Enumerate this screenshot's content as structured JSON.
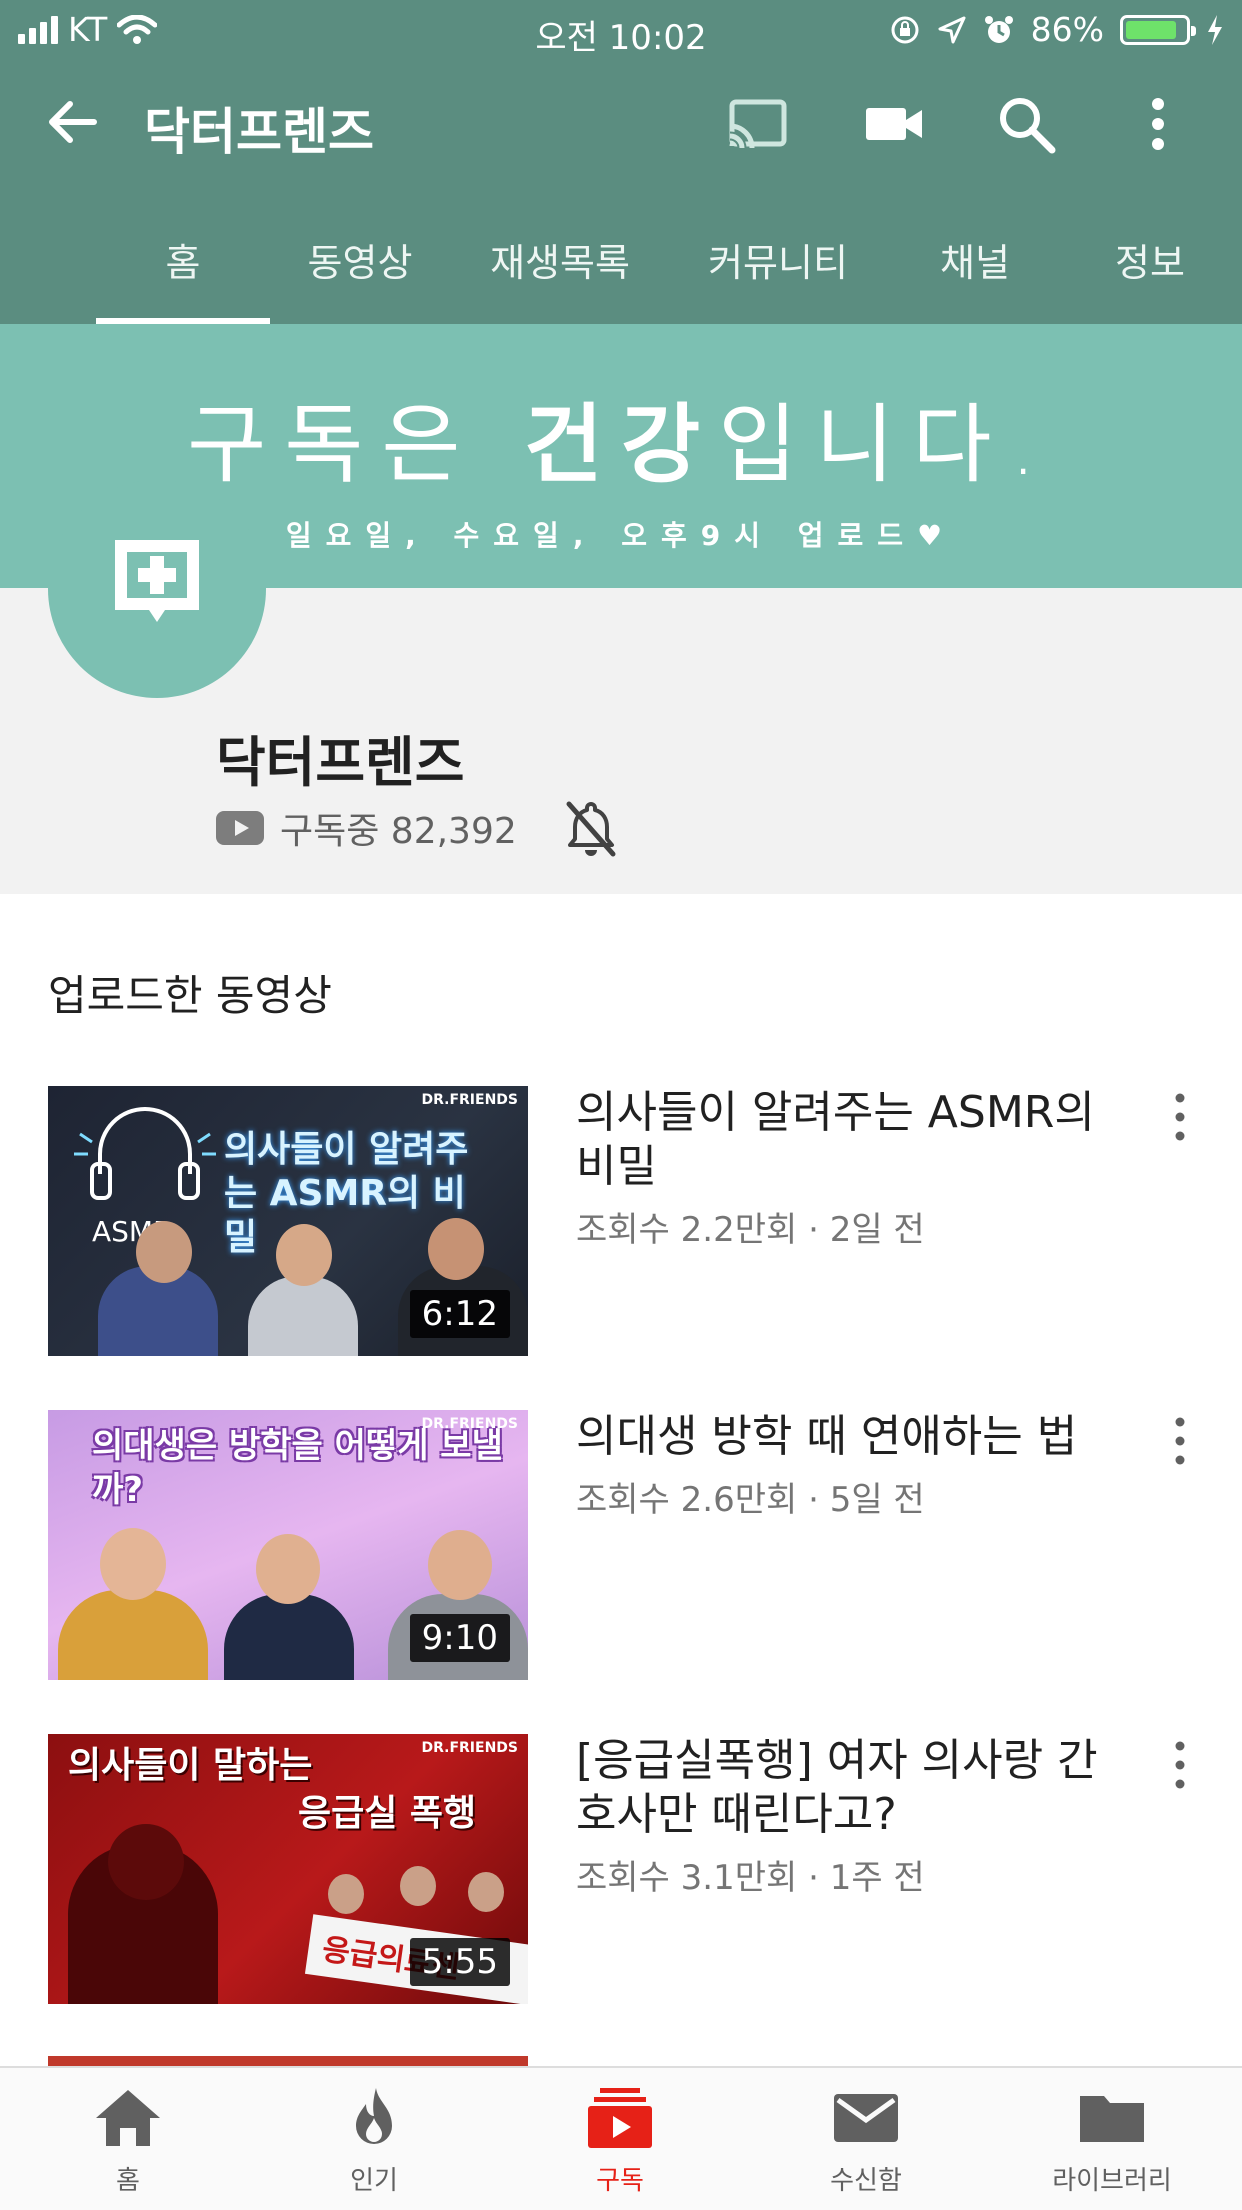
{
  "status_bar": {
    "carrier": "KT",
    "time": "오전 10:02",
    "battery": "86%",
    "battery_level": 0.86
  },
  "app_bar": {
    "title": "닥터프렌즈",
    "icons": [
      "back-arrow-icon",
      "cast-icon",
      "video-camera-icon",
      "search-icon",
      "more-vert-icon"
    ]
  },
  "tabs": [
    "홈",
    "동영상",
    "재생목록",
    "커뮤니티",
    "채널",
    "정보"
  ],
  "active_tab": "홈",
  "banner": {
    "line1_start": "구독은 ",
    "line1_bold": "건강",
    "line1_end": "입니다.",
    "line2": "일요일, 수요일, 오후9시 업로드♥"
  },
  "channel": {
    "name": "닥터프렌즈",
    "subscribed": "구독중 82,392"
  },
  "section_title": "업로드한 동영상",
  "videos": [
    {
      "title": "의사들이 알려주는 ASMR의 비밀",
      "meta": "조회수 2.2만회 · 2일 전",
      "duration": "6:12",
      "thumb_text": "의사들이 알려주는 ASMR의 비밀",
      "thumb_logo": "ASMR",
      "brand": "DR.FRIENDS"
    },
    {
      "title": "의대생 방학 때 연애하는 법",
      "meta": "조회수 2.6만회 · 5일 전",
      "duration": "9:10",
      "thumb_text": "의대생은 방학을 어떻게 보낼까?",
      "brand": "DR.FRIENDS"
    },
    {
      "title": "[응급실폭행] 여자 의사랑 간호사만 때린다고?",
      "meta": "조회수 3.1만회 · 1주 전",
      "duration": "5:55",
      "thumb_text_1": "의사들이 말하는",
      "thumb_text_2": "응급실 폭행",
      "thumb_sign": "응급의료센",
      "brand": "DR.FRIENDS"
    }
  ],
  "bottom_nav": [
    {
      "label": "홈",
      "icon": "home-icon"
    },
    {
      "label": "인기",
      "icon": "fire-icon"
    },
    {
      "label": "구독",
      "icon": "subscriptions-icon",
      "active": true
    },
    {
      "label": "수신함",
      "icon": "mail-icon"
    },
    {
      "label": "라이브러리",
      "icon": "folder-icon"
    }
  ],
  "colors": {
    "header": "#5b8d80",
    "banner": "#7cc0b2",
    "active_nav": "#e62117"
  }
}
